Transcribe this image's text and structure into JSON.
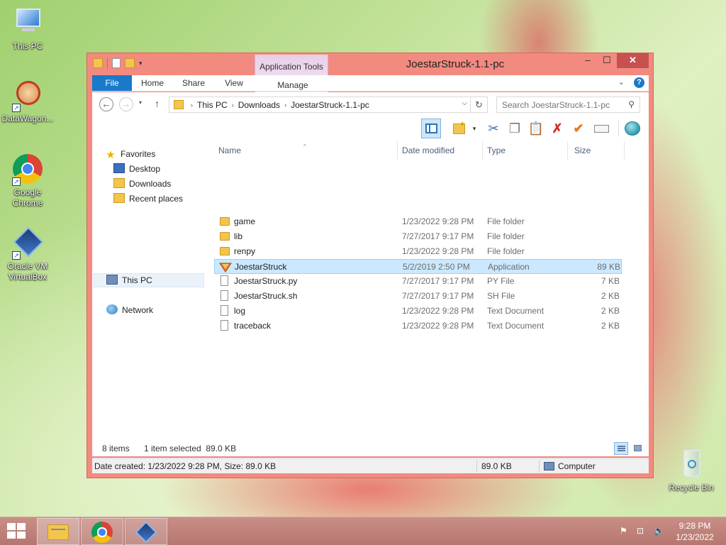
{
  "desktop": {
    "icons": [
      {
        "label": "This PC",
        "icon": "this-pc-icon"
      },
      {
        "label": "DataWagon...",
        "icon": "datawagon-icon"
      },
      {
        "label": "Google Chrome",
        "icon": "chrome-icon"
      },
      {
        "label": "Oracle VM VirtualBox",
        "icon": "virtualbox-icon"
      },
      {
        "label": "Recycle Bin",
        "icon": "recycle-bin-icon"
      }
    ]
  },
  "window": {
    "title": "JoestarStruck-1.1-pc",
    "context_tab_group": "Application Tools",
    "controls": {
      "minimize": "–",
      "maximize": "☐",
      "close": "✕"
    }
  },
  "ribbon": {
    "tabs": [
      "File",
      "Home",
      "Share",
      "View",
      "Manage"
    ],
    "expand_symbol": "⌄",
    "help_symbol": "?"
  },
  "address": {
    "back": "←",
    "forward": "→",
    "recent": "▾",
    "up": "↑",
    "breadcrumbs": [
      "This PC",
      "Downloads",
      "JoestarStruck-1.1-pc"
    ],
    "separator": "›",
    "dropdown": "⌵",
    "refresh": "↻",
    "search_placeholder": "Search JoestarStruck-1.1-pc",
    "search_symbol": "⚲"
  },
  "toolbar": {
    "new_folder_dropdown": "▾",
    "cut": "✂",
    "copy": "❐",
    "paste": "📋",
    "delete": "✗",
    "ok": "✔"
  },
  "navpane": {
    "favorites": "Favorites",
    "favorite_items": [
      "Desktop",
      "Downloads",
      "Recent places"
    ],
    "this_pc": "This PC",
    "network": "Network",
    "star": "★"
  },
  "columns": {
    "name": "Name",
    "date": "Date modified",
    "type": "Type",
    "size": "Size",
    "sort_caret": "^"
  },
  "files": [
    {
      "name": "game",
      "date": "1/23/2022 9:28 PM",
      "type": "File folder",
      "size": "",
      "icon": "folder"
    },
    {
      "name": "lib",
      "date": "7/27/2017 9:17 PM",
      "type": "File folder",
      "size": "",
      "icon": "folder"
    },
    {
      "name": "renpy",
      "date": "1/23/2022 9:28 PM",
      "type": "File folder",
      "size": "",
      "icon": "folder"
    },
    {
      "name": "JoestarStruck",
      "date": "5/2/2019 2:50 PM",
      "type": "Application",
      "size": "89 KB",
      "icon": "app",
      "selected": true
    },
    {
      "name": "JoestarStruck.py",
      "date": "7/27/2017 9:17 PM",
      "type": "PY File",
      "size": "7 KB",
      "icon": "doc"
    },
    {
      "name": "JoestarStruck.sh",
      "date": "7/27/2017 9:17 PM",
      "type": "SH File",
      "size": "2 KB",
      "icon": "doc"
    },
    {
      "name": "log",
      "date": "1/23/2022 9:28 PM",
      "type": "Text Document",
      "size": "2 KB",
      "icon": "doc"
    },
    {
      "name": "traceback",
      "date": "1/23/2022 9:28 PM",
      "type": "Text Document",
      "size": "2 KB",
      "icon": "doc"
    }
  ],
  "status": {
    "item_count": "8 items",
    "selection": "1 item selected  89.0 KB"
  },
  "details_bar": {
    "info": "Date created: 1/23/2022 9:28 PM, Size: 89.0 KB",
    "size": "89.0 KB",
    "location": "Computer"
  },
  "taskbar": {
    "apps": [
      "File Explorer",
      "Google Chrome",
      "Oracle VM VirtualBox"
    ],
    "tray_icons": [
      "action-center-icon",
      "network-icon",
      "volume-muted-icon"
    ],
    "tray_symbols": {
      "flag": "⚑",
      "network": "⊡",
      "volume": "🔈"
    },
    "time": "9:28 PM",
    "date": "1/23/2022"
  },
  "colors": {
    "accent": "#1979ca",
    "window_frame": "#f28a80",
    "selection": "#cce8ff",
    "close_button": "#c75050"
  }
}
